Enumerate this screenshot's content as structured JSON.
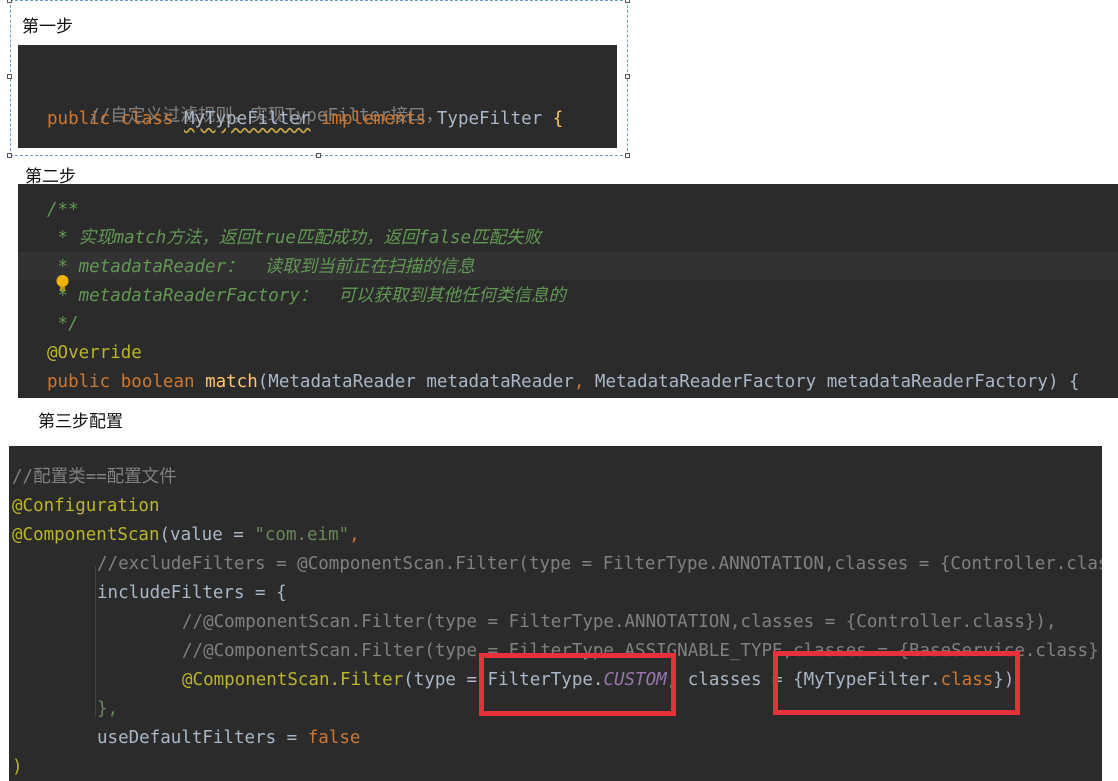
{
  "step1": {
    "label": "第一步",
    "comment": "//自定义过滤规则，实现TypeFilter接口，",
    "kw_public": "public",
    "kw_class": "class",
    "class_name": "MyTypeFilter",
    "kw_implements": "implements",
    "interface_name": "TypeFilter",
    "brace": "{"
  },
  "step2": {
    "label": "第二步",
    "doc_open": "/**",
    "doc_line1": " * 实现match方法，返回true匹配成功，返回false匹配失败",
    "doc_line2": " * metadataReader：  读取到当前正在扫描的信息",
    "doc_line3": " * metadataReaderFactory：  可以获取到其他任何类信息的",
    "doc_close": " */",
    "annotation": "@Override",
    "kw_public": "public",
    "kw_boolean": "boolean",
    "method_name": "match",
    "params": "(MetadataReader metadataReader",
    "comma": ",",
    "params2": " MetadataReaderFactory metadataReaderFactory) {"
  },
  "step3": {
    "label": "第三步配置",
    "comment": "//配置类==配置文件",
    "ann_config": "@Configuration",
    "ann_scan": "@ComponentScan",
    "value_key": "(value = ",
    "value_str": "\"com.eim\"",
    "comma": ",",
    "exclude_comment": "//excludeFilters = @ComponentScan.Filter(type = FilterType.ANNOTATION,classes = {Controller.class",
    "include_key": "includeFilters = {",
    "filter_comment1": "//@ComponentScan.Filter(type = FilterType.ANNOTATION,classes = {Controller.class}),",
    "filter_comment2": "//@ComponentScan.Filter(type = FilterType.ASSIGNABLE_TYPE,classes = {BaseService.class}",
    "filter_ann": "@ComponentScan.Filter",
    "filter_type_part": "(type = FilterType.",
    "custom": "CUSTOM",
    "classes_part": ", classes = {MyTypeFilter.",
    "kw_class": "class",
    "close_part": "})",
    "close_brace": "},",
    "default_key": "useDefaultFilters = ",
    "kw_false": "false",
    "close_paren": ")"
  },
  "colors": {
    "editor_bg": "#2b2b2b",
    "keyword": "#cc7832",
    "function": "#ffc66d",
    "string": "#6a8759",
    "annotation": "#bbb529",
    "comment": "#808080",
    "doc_comment": "#629755",
    "constant": "#9876aa",
    "highlight_box": "#e8303a"
  },
  "icons": [
    "lightbulb-icon"
  ]
}
